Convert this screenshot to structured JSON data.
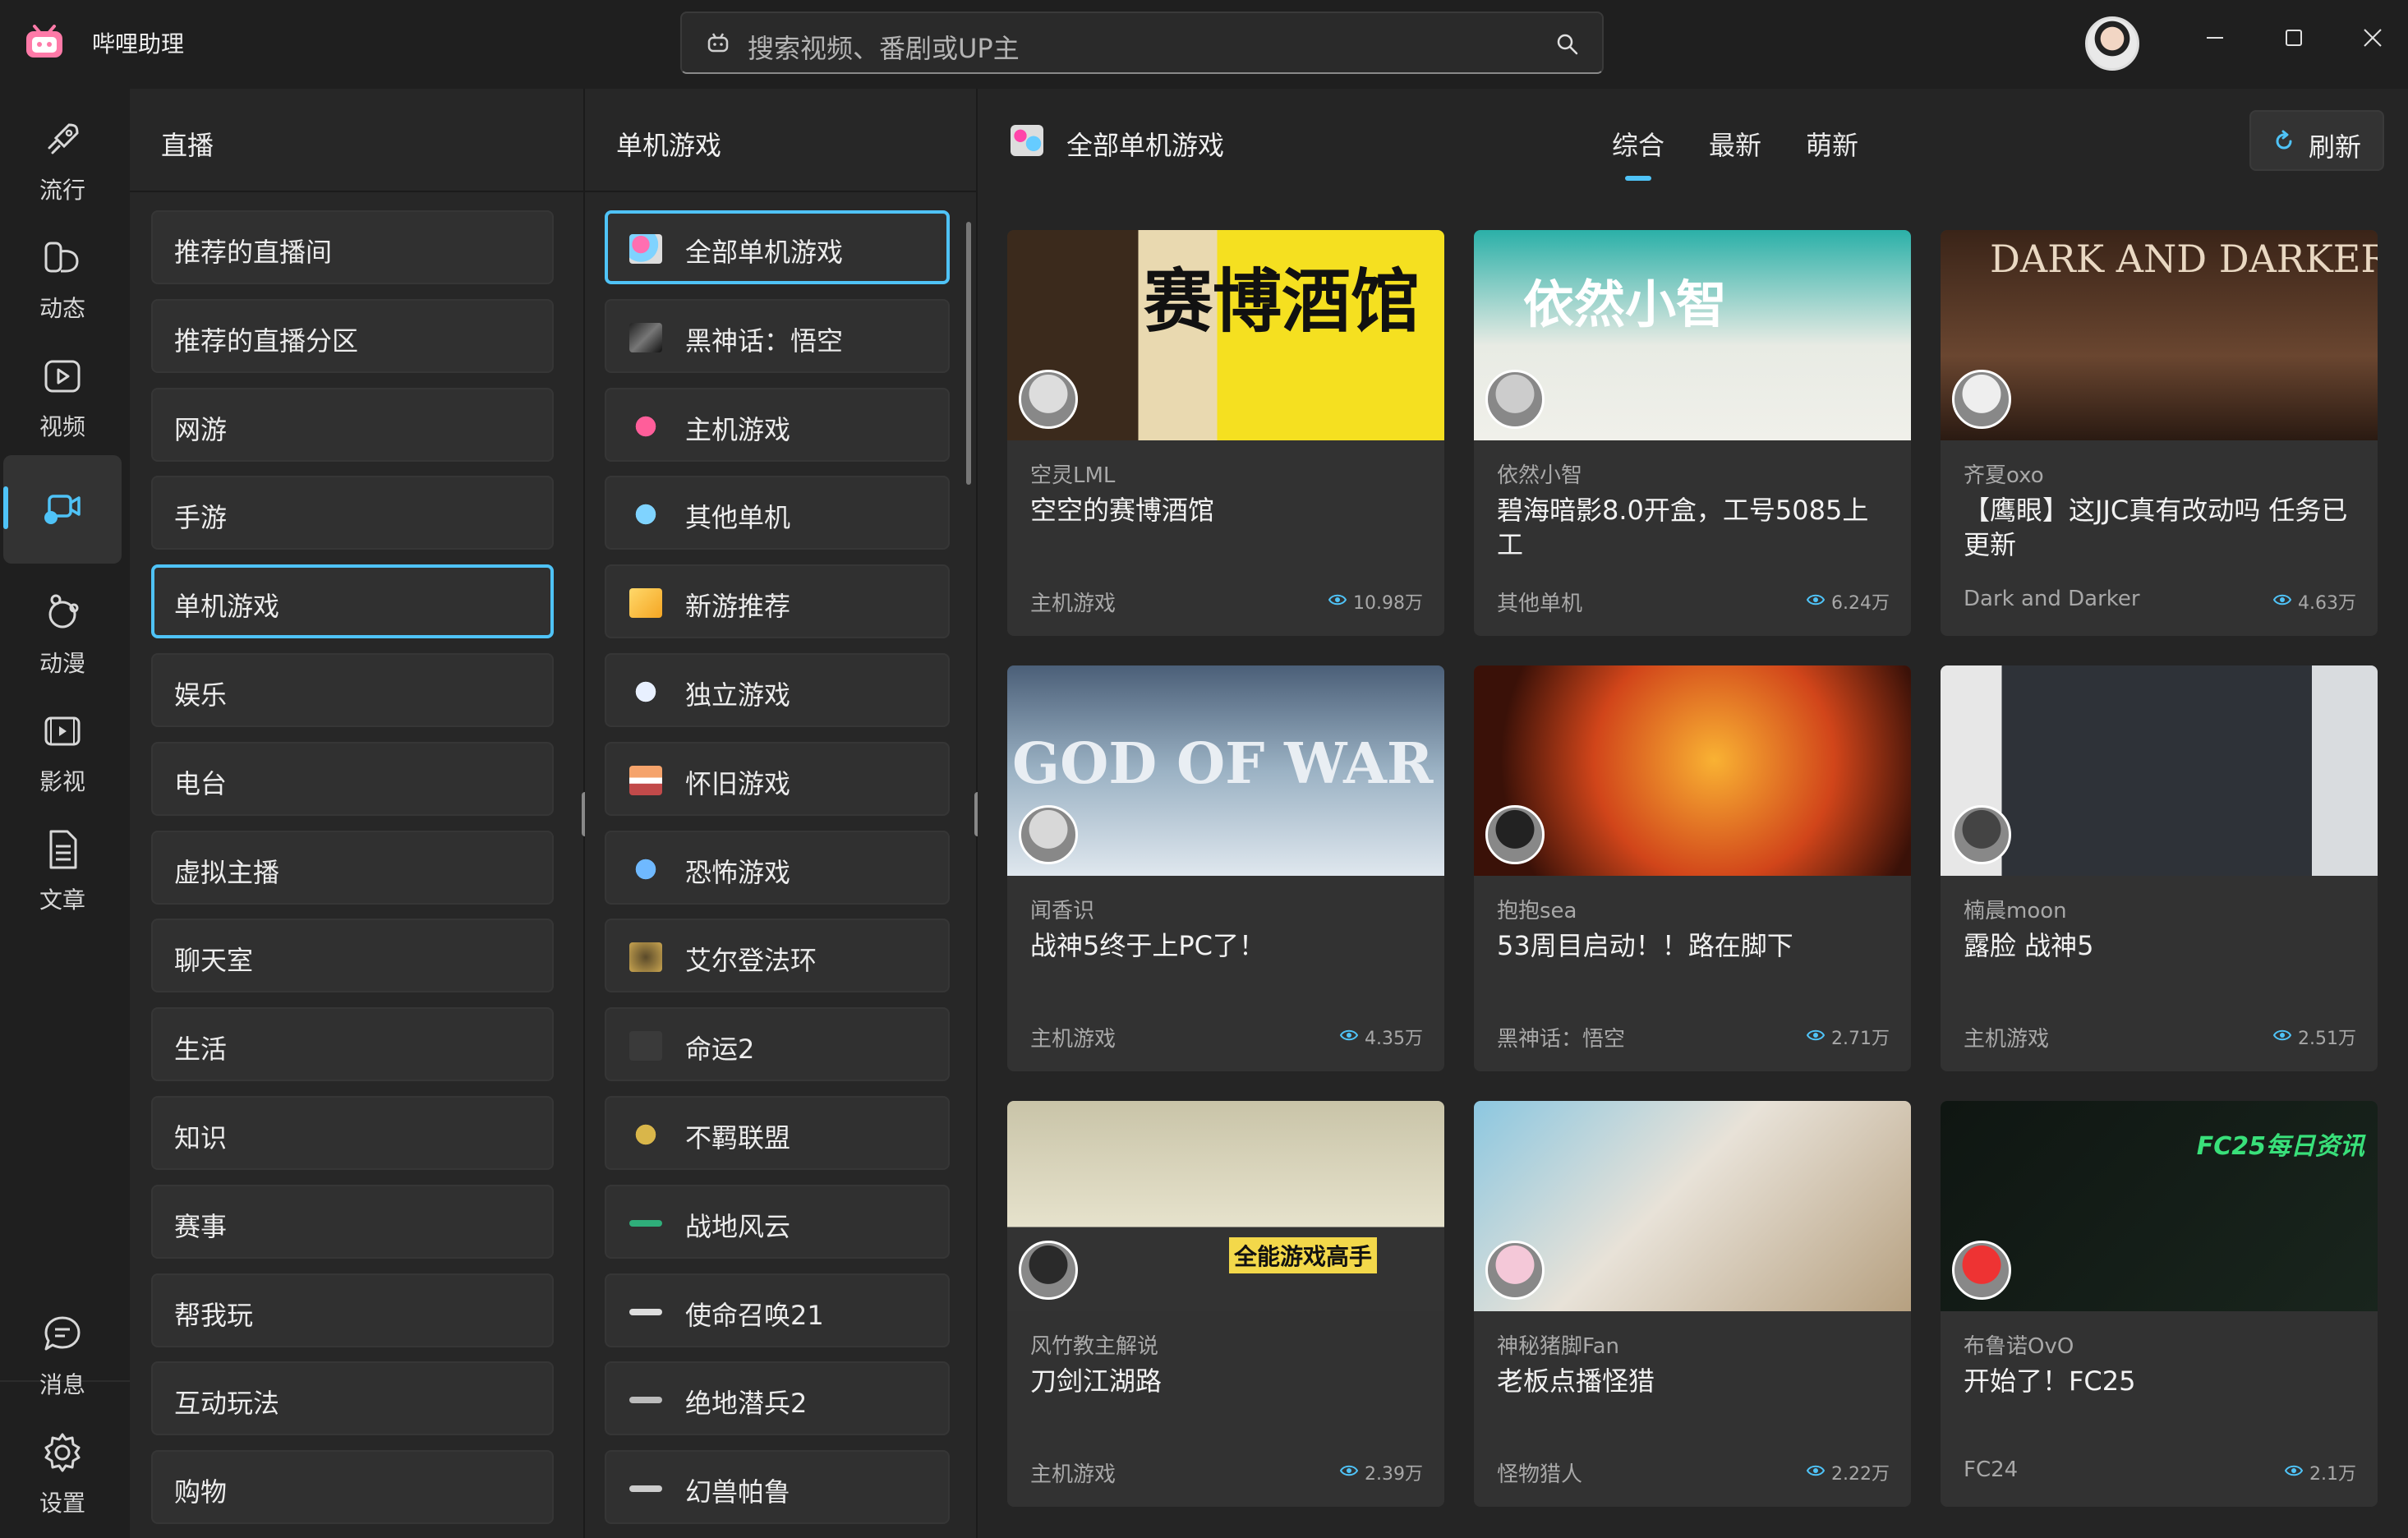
{
  "app": {
    "title": "哔哩助理",
    "logo_icon": "bilibili-tv-icon"
  },
  "search": {
    "placeholder": "搜索视频、番剧或UP主"
  },
  "window_controls": [
    "minimize-icon",
    "maximize-icon",
    "close-icon"
  ],
  "nav": {
    "items": [
      {
        "label": "流行",
        "icon": "rocket-icon"
      },
      {
        "label": "动态",
        "icon": "feed-icon"
      },
      {
        "label": "视频",
        "icon": "video-icon"
      },
      {
        "label": "直播",
        "icon": "live-camera-icon",
        "active": true
      },
      {
        "label": "动漫",
        "icon": "anime-icon"
      },
      {
        "label": "影视",
        "icon": "film-icon"
      },
      {
        "label": "文章",
        "icon": "article-icon"
      }
    ],
    "bottom": [
      {
        "label": "消息",
        "icon": "message-icon"
      },
      {
        "label": "设置",
        "icon": "gear-icon"
      }
    ]
  },
  "panel1": {
    "title": "直播",
    "items": [
      "推荐的直播间",
      "推荐的直播分区",
      "网游",
      "手游",
      "单机游戏",
      "娱乐",
      "电台",
      "虚拟主播",
      "聊天室",
      "生活",
      "知识",
      "赛事",
      "帮我玩",
      "互动玩法",
      "购物"
    ],
    "selected_index": 4
  },
  "panel2": {
    "title": "单机游戏",
    "items": [
      "全部单机游戏",
      "黑神话：悟空",
      "主机游戏",
      "其他单机",
      "新游推荐",
      "独立游戏",
      "怀旧游戏",
      "恐怖游戏",
      "艾尔登法环",
      "命运2",
      "不羁联盟",
      "战地风云",
      "使命召唤21",
      "绝地潜兵2",
      "幻兽帕鲁"
    ],
    "selected_index": 0
  },
  "main": {
    "title": "全部单机游戏",
    "tabs": [
      "综合",
      "最新",
      "萌新"
    ],
    "active_tab": 0,
    "refresh_label": "刷新",
    "cards": [
      {
        "owner": "空灵LML",
        "title": "空空的赛博酒馆",
        "tag": "主机游戏",
        "views": "10.98万",
        "cover_text": "赛博酒馆"
      },
      {
        "owner": "依然小智",
        "title": "碧海暗影8.0开盒，工号5085上工",
        "tag": "其他单机",
        "views": "6.24万",
        "cover_text": "依然小智"
      },
      {
        "owner": "齐夏oxo",
        "title": "【鹰眼】这JJC真有改动吗 任务已更新",
        "tag": "Dark and Darker",
        "views": "4.63万",
        "cover_text": "DARK AND DARKER"
      },
      {
        "owner": "闻香识",
        "title": "战神5终于上PC了！",
        "tag": "主机游戏",
        "views": "4.35万",
        "cover_text": "GOD OF WAR"
      },
      {
        "owner": "抱抱sea",
        "title": "53周目启动！！路在脚下",
        "tag": "黑神话：悟空",
        "views": "2.71万",
        "cover_text": ""
      },
      {
        "owner": "楠晨moon",
        "title": "露脸 战神5",
        "tag": "主机游戏",
        "views": "2.51万",
        "cover_text": ""
      },
      {
        "owner": "风竹教主解说",
        "title": "刀剑江湖路",
        "tag": "主机游戏",
        "views": "2.39万",
        "cover_text": "全能游戏高手"
      },
      {
        "owner": "神秘猪脚Fan",
        "title": "老板点播怪猎",
        "tag": "怪物猎人",
        "views": "2.22万",
        "cover_text": ""
      },
      {
        "owner": "布鲁诺OvO",
        "title": "开始了！FC25",
        "tag": "FC24",
        "views": "2.1万",
        "cover_text": "FC25每日资讯"
      }
    ]
  },
  "colors": {
    "accent": "#4fc3f7",
    "background": "#1f1f1f",
    "card": "#323232"
  }
}
